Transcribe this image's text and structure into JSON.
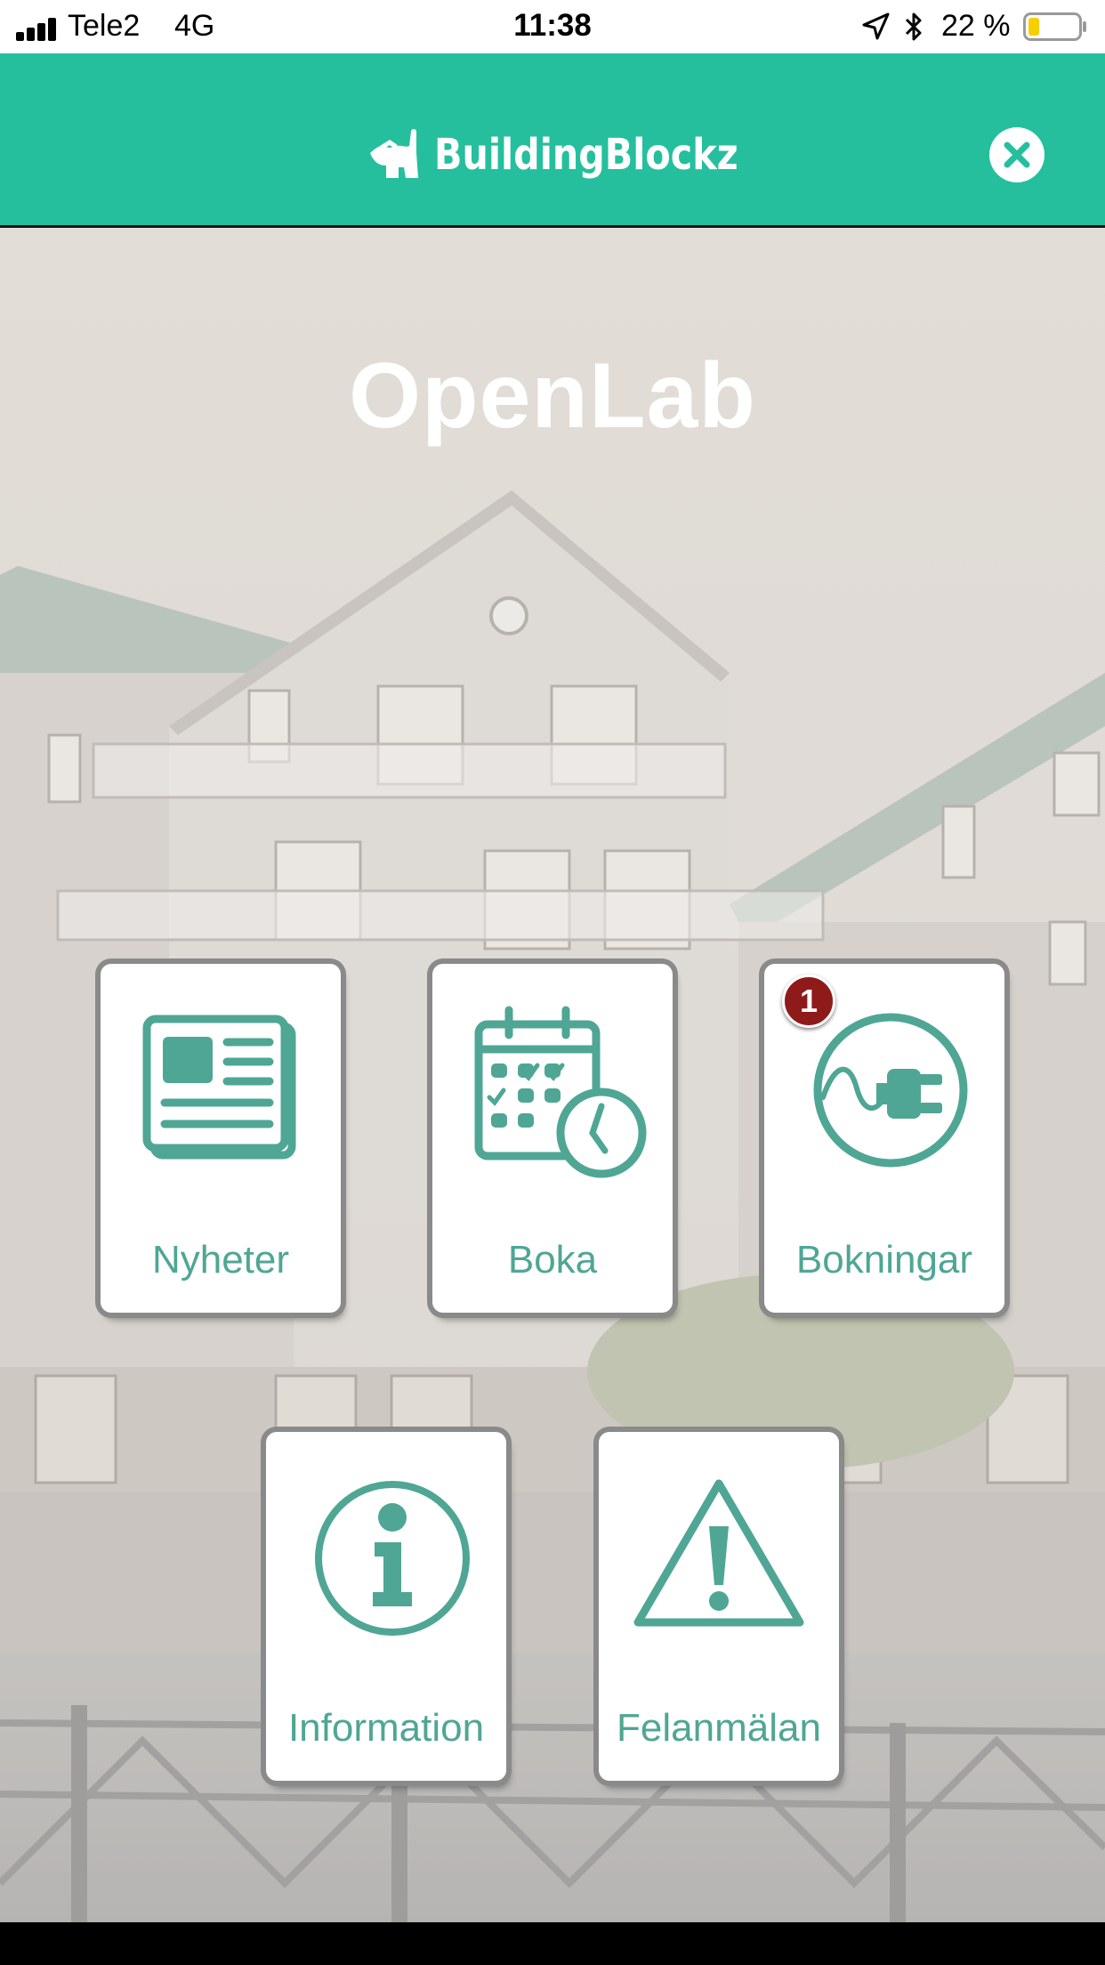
{
  "status_bar": {
    "carrier": "Tele2",
    "network": "4G",
    "time": "11:38",
    "battery_percent": "22 %",
    "battery_level": 0.22,
    "icons": [
      "signal-icon",
      "location-icon",
      "bluetooth-icon",
      "battery-icon"
    ]
  },
  "header": {
    "logo_text": "BuildingBlockz",
    "close_icon": "close-icon",
    "background_color": "#25bf9e"
  },
  "main": {
    "title": "OpenLab",
    "tiles": [
      {
        "label": "Nyheter",
        "icon": "newspaper-icon"
      },
      {
        "label": "Boka",
        "icon": "calendar-clock-icon"
      },
      {
        "label": "Bokningar",
        "icon": "plug-icon",
        "badge": "1"
      },
      {
        "label": "Information",
        "icon": "info-icon"
      },
      {
        "label": "Felanmälan",
        "icon": "warning-icon"
      }
    ],
    "accent_color": "#4fa694",
    "badge_color": "#8f1a1a"
  }
}
